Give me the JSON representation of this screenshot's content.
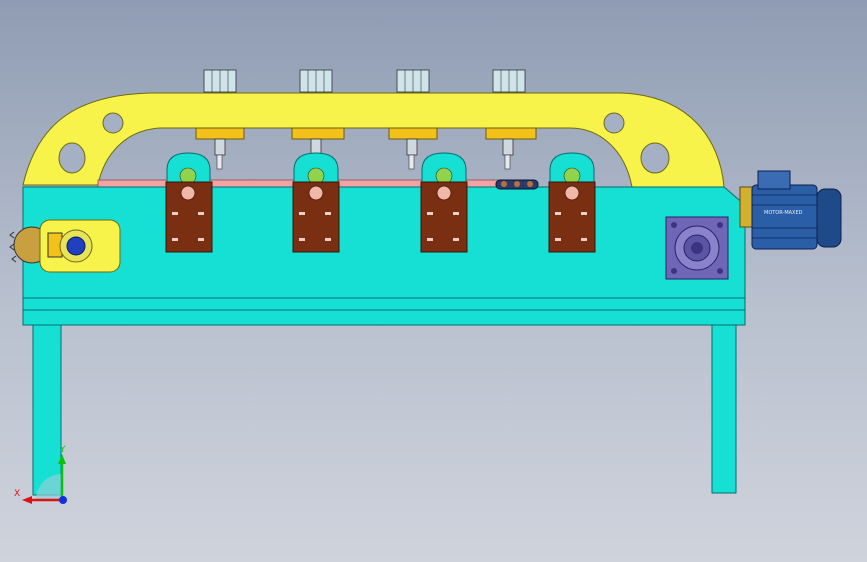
{
  "viewport": {
    "background_top": "#8f9cb3",
    "background_bottom": "#cfd3dc"
  },
  "motor": {
    "nameplate": "MOTOR-MAXED"
  },
  "triad": {
    "x_label": "X",
    "y_label": "Y",
    "x_color": "#e01010",
    "y_color": "#10c010",
    "z_color": "#1030e0"
  },
  "colors": {
    "frame_cyan": "#16e0d4",
    "arch_yellow": "#f7f34a",
    "bracket_brown": "#7a2e12",
    "rail_pink": "#f2a3a6",
    "bearing_purple": "#6f66b8",
    "motor_blue": "#2a5fa8"
  },
  "components": {
    "spindle_count": 4,
    "clamp_count": 4
  }
}
